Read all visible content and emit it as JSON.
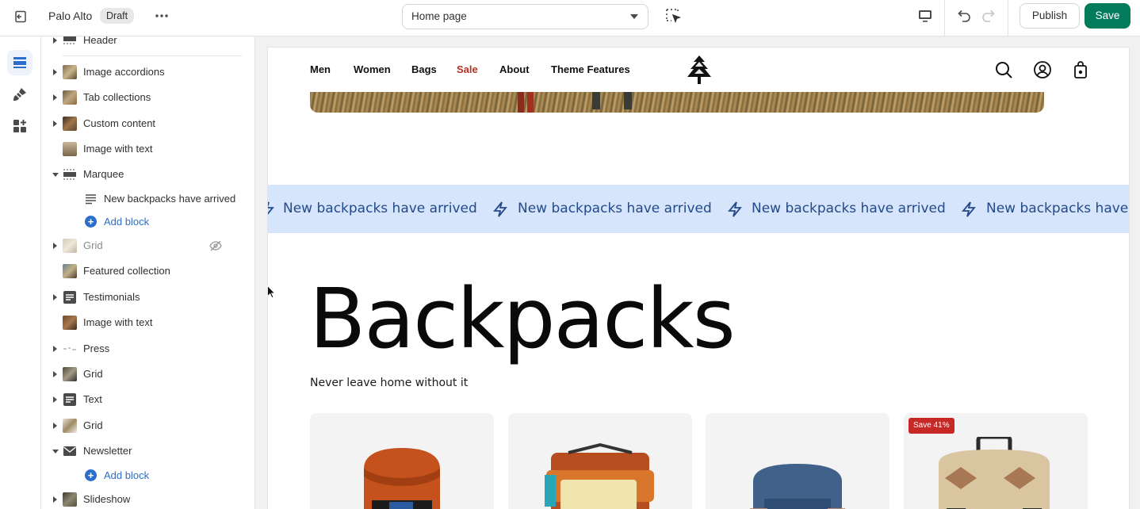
{
  "topbar": {
    "store_name": "Palo Alto",
    "status_badge": "Draft",
    "page_selector": "Home page",
    "publish_label": "Publish",
    "save_label": "Save"
  },
  "colors": {
    "save": "#047b5d",
    "link": "#2c6ecb",
    "sale": "#b23323",
    "marquee_bg": "#d6e5fb",
    "marquee_text": "#234a8a",
    "save_badge": "#c62828"
  },
  "rail": [
    "sections-icon",
    "theme-settings-icon",
    "app-embeds-icon"
  ],
  "sidebar": {
    "sections": [
      {
        "label": "Header",
        "arrow": "right"
      },
      {
        "label": "Image accordions",
        "arrow": "right"
      },
      {
        "label": "Tab collections",
        "arrow": "right"
      },
      {
        "label": "Custom content",
        "arrow": "right"
      },
      {
        "label": "Image with text",
        "arrow": "none"
      },
      {
        "label": "Marquee",
        "arrow": "down"
      },
      {
        "label": "Grid",
        "arrow": "right",
        "hidden": true
      },
      {
        "label": "Featured collection",
        "arrow": "none"
      },
      {
        "label": "Testimonials",
        "arrow": "right"
      },
      {
        "label": "Image with text",
        "arrow": "none"
      },
      {
        "label": "Press",
        "arrow": "right"
      },
      {
        "label": "Grid",
        "arrow": "right"
      },
      {
        "label": "Text",
        "arrow": "right"
      },
      {
        "label": "Grid",
        "arrow": "right"
      },
      {
        "label": "Newsletter",
        "arrow": "down"
      },
      {
        "label": "Slideshow",
        "arrow": "right"
      }
    ],
    "marquee_block": "New backpacks have arrived",
    "add_block_label": "Add block"
  },
  "store": {
    "nav": [
      "Men",
      "Women",
      "Bags",
      "Sale",
      "About",
      "Theme Features"
    ],
    "marquee_text": "New backpacks have arrived",
    "heading": "Backpacks",
    "subheading": "Never leave home without it",
    "badge": "Save 41%"
  }
}
